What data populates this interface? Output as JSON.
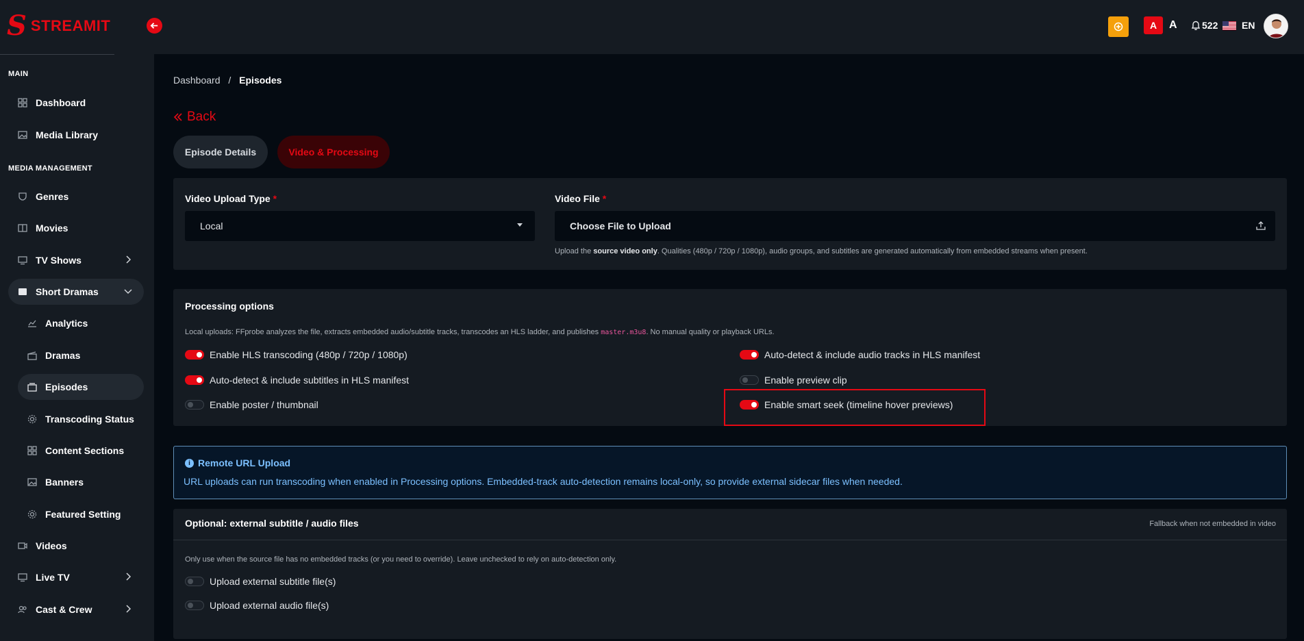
{
  "brand": {
    "name": "STREAMIT",
    "initial": "S"
  },
  "sidebar": {
    "sections": [
      {
        "title": "MAIN"
      },
      {
        "title": "MEDIA MANAGEMENT"
      }
    ],
    "items": [
      {
        "label": "Dashboard"
      },
      {
        "label": "Media Library"
      },
      {
        "label": "Genres"
      },
      {
        "label": "Movies"
      },
      {
        "label": "TV Shows"
      },
      {
        "label": "Short Dramas"
      },
      {
        "label": "Analytics"
      },
      {
        "label": "Dramas"
      },
      {
        "label": "Episodes"
      },
      {
        "label": "Transcoding Status"
      },
      {
        "label": "Content Sections"
      },
      {
        "label": "Banners"
      },
      {
        "label": "Featured Setting"
      },
      {
        "label": "Videos"
      },
      {
        "label": "Live TV"
      },
      {
        "label": "Cast & Crew"
      }
    ]
  },
  "topbar": {
    "font_a1": "A",
    "font_a2": "A",
    "notifications": "522",
    "language": "EN"
  },
  "breadcrumb": {
    "root": "Dashboard",
    "separator": "/",
    "current": "Episodes"
  },
  "back_label": "Back",
  "tabs": [
    {
      "label": "Episode Details"
    },
    {
      "label": "Video & Processing"
    }
  ],
  "upload": {
    "type_label": "Video Upload Type",
    "type_value": "Local",
    "file_label": "Video File",
    "file_placeholder": "Choose File to Upload",
    "required_mark": "*",
    "hint_pre": "Upload the",
    "hint_bold": "source video only",
    "hint_post": ". Qualities (480p / 720p / 1080p), audio groups, and subtitles are generated automatically from embedded streams when present."
  },
  "processing": {
    "title": "Processing options",
    "desc_pre": "Local uploads: FFprobe analyzes the file, extracts embedded audio/subtitle tracks, transcodes an HLS ladder, and publishes",
    "desc_code": "master.m3u8",
    "desc_post": ". No manual quality or playback URLs.",
    "options": [
      {
        "label": "Enable HLS transcoding (480p / 720p / 1080p)",
        "enabled": true
      },
      {
        "label": "Auto-detect & include subtitles in HLS manifest",
        "enabled": true
      },
      {
        "label": "Enable poster / thumbnail",
        "enabled": false
      },
      {
        "label": "Auto-detect & include audio tracks in HLS manifest",
        "enabled": true
      },
      {
        "label": "Enable preview clip",
        "enabled": false
      },
      {
        "label": "Enable smart seek (timeline hover previews)",
        "enabled": true
      }
    ]
  },
  "remote_info": {
    "icon": "i",
    "title": "Remote URL Upload",
    "text": "URL uploads can run transcoding when enabled in Processing options. Embedded-track auto-detection remains local-only, so provide external sidecar files when needed."
  },
  "external": {
    "title": "Optional: external subtitle / audio files",
    "right_note": "Fallback when not embedded in video",
    "desc": "Only use when the source file has no embedded tracks (or you need to override). Leave unchecked to rely on auto-detection only.",
    "options": [
      {
        "label": "Upload external subtitle file(s)",
        "enabled": false
      },
      {
        "label": "Upload external audio file(s)",
        "enabled": false
      }
    ]
  },
  "colors": {
    "accent": "#e50914",
    "info": "#7cc0ff",
    "gift": "#f5a00b"
  }
}
